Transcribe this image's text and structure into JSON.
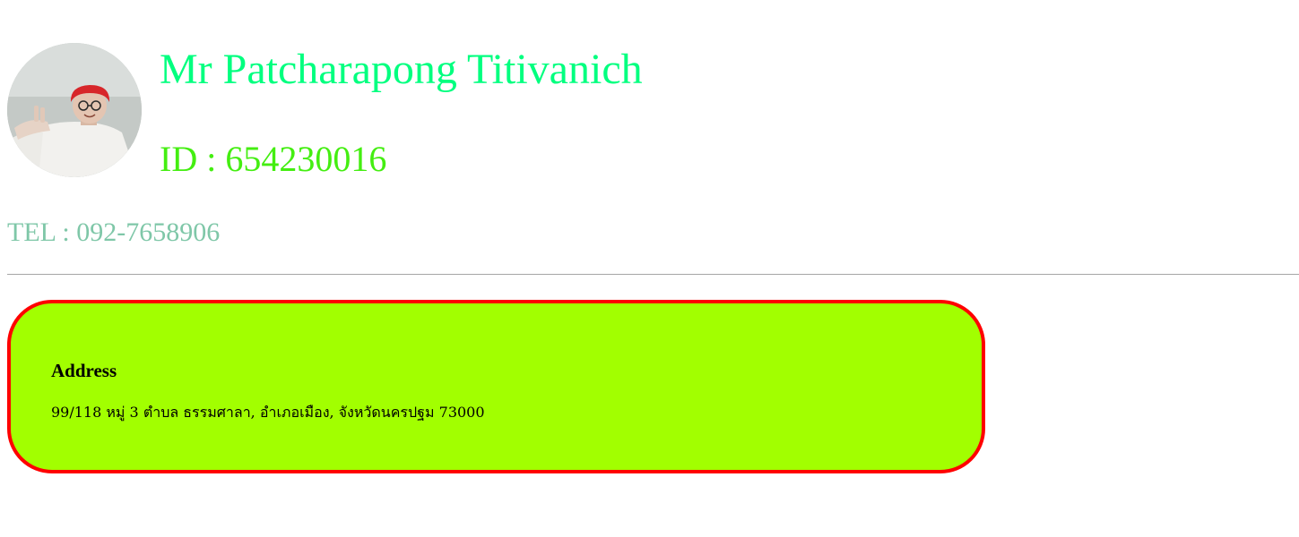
{
  "profile": {
    "avatar_icon": "profile-photo",
    "name": "Mr Patcharapong Titivanich",
    "student_id": "ID : 654230016",
    "tel": "TEL : 092-7658906"
  },
  "address": {
    "title": "Address",
    "text": "99/118 หมู่ 3 ตำบล ธรรมศาลา, อำเภอเมือง, จังหวัดนครปฐม 73000"
  },
  "colors": {
    "name": "#00ff7f",
    "student_id": "#44ee11",
    "tel": "#7fc7a8",
    "card_background": "#a2ff00",
    "card_border": "#ff0000"
  }
}
